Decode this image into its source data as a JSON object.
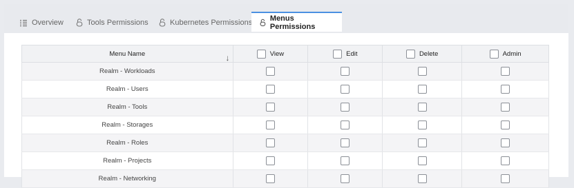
{
  "tabs": [
    {
      "label": "Overview",
      "icon": "list-icon",
      "active": false
    },
    {
      "label": "Tools Permissions",
      "icon": "lock-icon",
      "active": false
    },
    {
      "label": "Kubernetes Permissions",
      "icon": "lock-icon",
      "active": false
    },
    {
      "label": "Menus Permissions",
      "icon": "lock-icon",
      "active": true
    }
  ],
  "table": {
    "columns": [
      "Menu Name",
      "View",
      "Edit",
      "Delete",
      "Admin"
    ],
    "rows": [
      "Realm - Workloads",
      "Realm - Users",
      "Realm - Tools",
      "Realm - Storages",
      "Realm - Roles",
      "Realm - Projects",
      "Realm - Networking"
    ]
  },
  "colors": {
    "accent": "#4a90e2"
  }
}
